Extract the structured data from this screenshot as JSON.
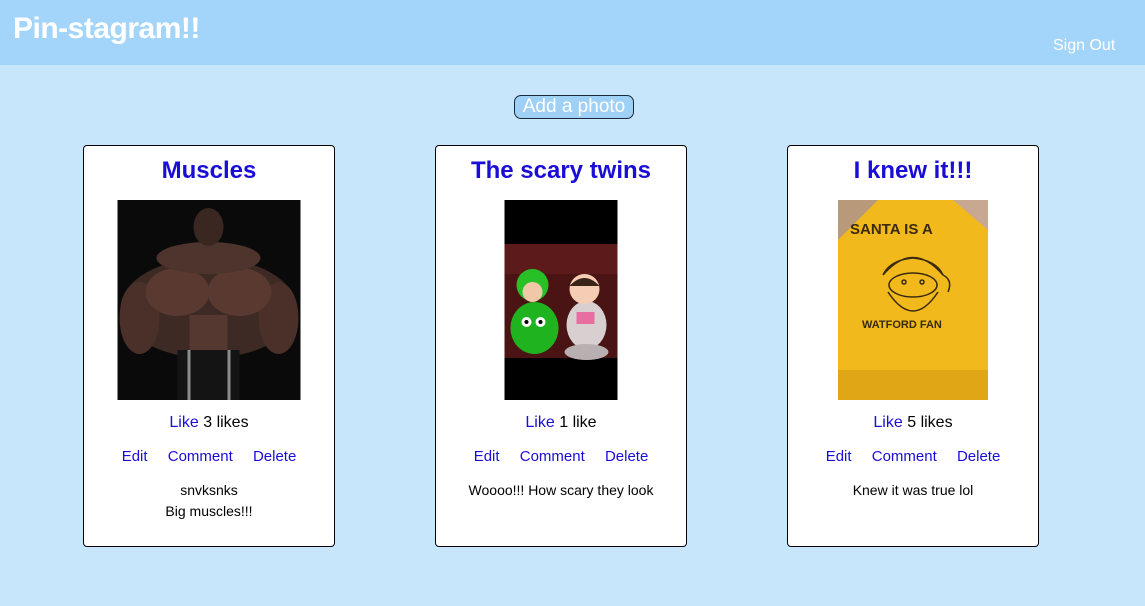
{
  "header": {
    "title": "Pin-stagram!!",
    "sign_out": "Sign Out"
  },
  "add_photo_label": "Add a photo",
  "posts": [
    {
      "title": "Muscles",
      "like_label": "Like",
      "likes_text": "3 likes",
      "edit_label": "Edit",
      "comment_label": "Comment",
      "delete_label": "Delete",
      "comments": [
        "snvksnks",
        "Big muscles!!!"
      ]
    },
    {
      "title": "The scary twins",
      "like_label": "Like",
      "likes_text": "1 like",
      "edit_label": "Edit",
      "comment_label": "Comment",
      "delete_label": "Delete",
      "comments": [
        "Woooo!!! How scary they look"
      ]
    },
    {
      "title": "I knew it!!!",
      "like_label": "Like",
      "likes_text": "5 likes",
      "edit_label": "Edit",
      "comment_label": "Comment",
      "delete_label": "Delete",
      "comments": [
        "Knew it was true lol"
      ],
      "shirt_text_top": "SANTA IS A",
      "shirt_text_bottom": "WATFORD FAN"
    }
  ],
  "colors": {
    "header": "#a3d5fa",
    "background": "#c8e6fb",
    "link": "#1a0dd6",
    "shirt": "#f2b91c"
  }
}
